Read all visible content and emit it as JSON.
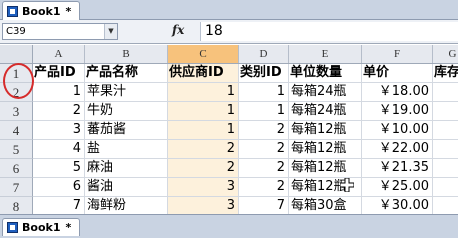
{
  "window": {
    "tab_title": "Book1",
    "modified_marker": "*"
  },
  "formula_bar": {
    "name_box": "C39",
    "fx_label": "fx",
    "value": "18"
  },
  "columns": [
    "A",
    "B",
    "C",
    "D",
    "E",
    "F",
    "G"
  ],
  "selected_column": "C",
  "row_numbers": [
    "1",
    "2",
    "3",
    "4",
    "5",
    "6",
    "7",
    "8"
  ],
  "table": {
    "headers": [
      "产品ID",
      "产品名称",
      "供应商ID",
      "类别ID",
      "单位数量",
      "单价",
      "库存"
    ],
    "rows": [
      [
        "1",
        "苹果汁",
        "1",
        "1",
        "每箱24瓶",
        "￥18.00"
      ],
      [
        "2",
        "牛奶",
        "1",
        "1",
        "每箱24瓶",
        "￥19.00"
      ],
      [
        "3",
        "蕃茄酱",
        "1",
        "2",
        "每箱12瓶",
        "￥10.00"
      ],
      [
        "4",
        "盐",
        "2",
        "2",
        "每箱12瓶",
        "￥22.00"
      ],
      [
        "5",
        "麻油",
        "2",
        "2",
        "每箱12瓶",
        "￥21.35"
      ],
      [
        "6",
        "酱油",
        "3",
        "2",
        "每箱12瓶",
        "￥25.00"
      ],
      [
        "7",
        "海鲜粉",
        "3",
        "7",
        "每箱30盒",
        "￥30.00"
      ]
    ]
  },
  "sheet_tab": {
    "title": "Book1",
    "modified_marker": "*"
  },
  "colors": {
    "selected_column_header": "#f7c27c",
    "annotation_circle": "#d62b2b"
  },
  "icons": {
    "workbook": "workbook-icon",
    "cursor": "cell-cursor-icon"
  }
}
